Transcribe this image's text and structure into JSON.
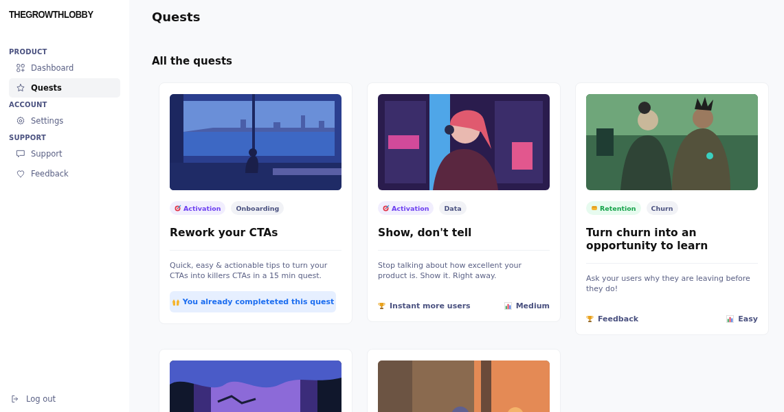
{
  "sidebar": {
    "logo": "THEGROWTHLOBBY",
    "sections": [
      {
        "title": "PRODUCT",
        "items": [
          {
            "label": "Dashboard",
            "selected": false
          },
          {
            "label": "Quests",
            "selected": true
          }
        ]
      },
      {
        "title": "ACCOUNT",
        "items": [
          {
            "label": "Settings",
            "selected": false
          }
        ]
      },
      {
        "title": "SUPPORT",
        "items": [
          {
            "label": "Support",
            "selected": false
          },
          {
            "label": "Feedback",
            "selected": false
          }
        ]
      }
    ],
    "logout": "Log out"
  },
  "page_title": "Quests",
  "section_title": "All the quests",
  "cards": [
    {
      "kind": "picture",
      "tags": [
        {
          "label": "Activation",
          "kind": "activation"
        },
        {
          "label": "Onboarding",
          "kind": "topic"
        }
      ],
      "title": "Rework your CTAs",
      "description": "Quick, easy & actionable tips to turn your CTAs into killers CTAs in a 15 min quest.",
      "completed": true,
      "status": "You already completeted this quest"
    },
    {
      "kind": "picture",
      "tags": [
        {
          "label": "Activation",
          "kind": "activation"
        },
        {
          "label": "Data",
          "kind": "topic"
        }
      ],
      "title": "Show, don't tell",
      "description": "Stop talking about how excellent your product is. Show it. Right away.",
      "completed": false,
      "reward": "Instant more users",
      "difficulty": "Medium"
    },
    {
      "kind": "picture",
      "tags": [
        {
          "label": "Retention",
          "kind": "retention"
        },
        {
          "label": "Churn",
          "kind": "topic"
        }
      ],
      "title": "Turn churn into an opportunity to learn",
      "description": "Ask your users why they are leaving before they do!",
      "completed": false,
      "reward": "Feedback",
      "difficulty": "Easy"
    },
    {
      "kind": "picture"
    },
    {
      "kind": "picture"
    }
  ]
}
